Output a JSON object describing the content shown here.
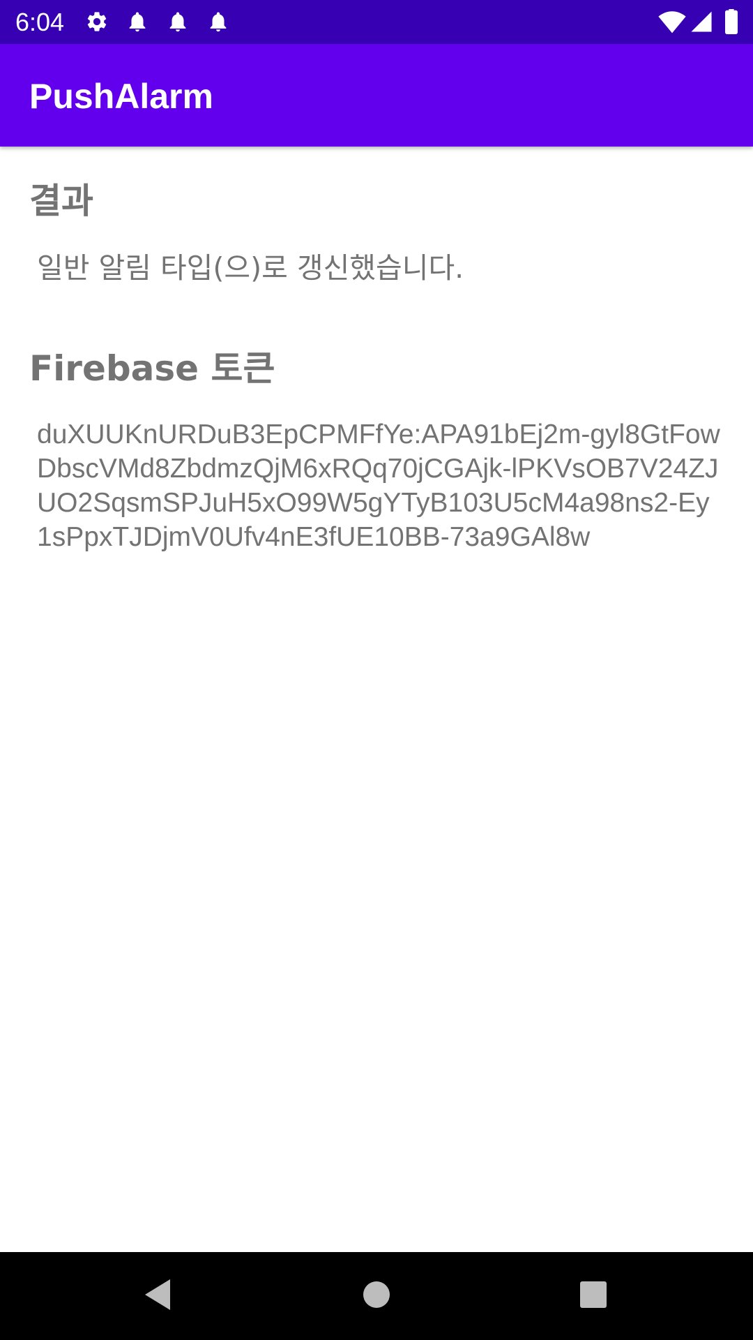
{
  "status_bar": {
    "time": "6:04",
    "icons": [
      "gear-icon",
      "bell-icon",
      "bell-icon",
      "bell-icon",
      "wifi-icon",
      "signal-icon",
      "battery-icon"
    ],
    "background": "#3700B3"
  },
  "app_bar": {
    "title": "PushAlarm",
    "background": "#6200EE"
  },
  "result": {
    "heading": "결과",
    "message": "일반 알림 타입(으)로 갱신했습니다."
  },
  "token": {
    "heading": "Firebase 토큰",
    "value": "duXUUKnURDuB3EpCPMFfYe:APA91bEj2m-gyl8GtFowDbscVMd8ZbdmzQjM6xRQq70jCGAjk-lPKVsOB7V24ZJUO2SqsmSPJuH5xO99W5gYTyB103U5cM4a98ns2-Ey1sPpxTJDjmV0Ufv4nE3fUE10BB-73a9GAl8w"
  },
  "nav_bar": {
    "buttons": [
      "back-icon",
      "home-icon",
      "recents-icon"
    ]
  }
}
